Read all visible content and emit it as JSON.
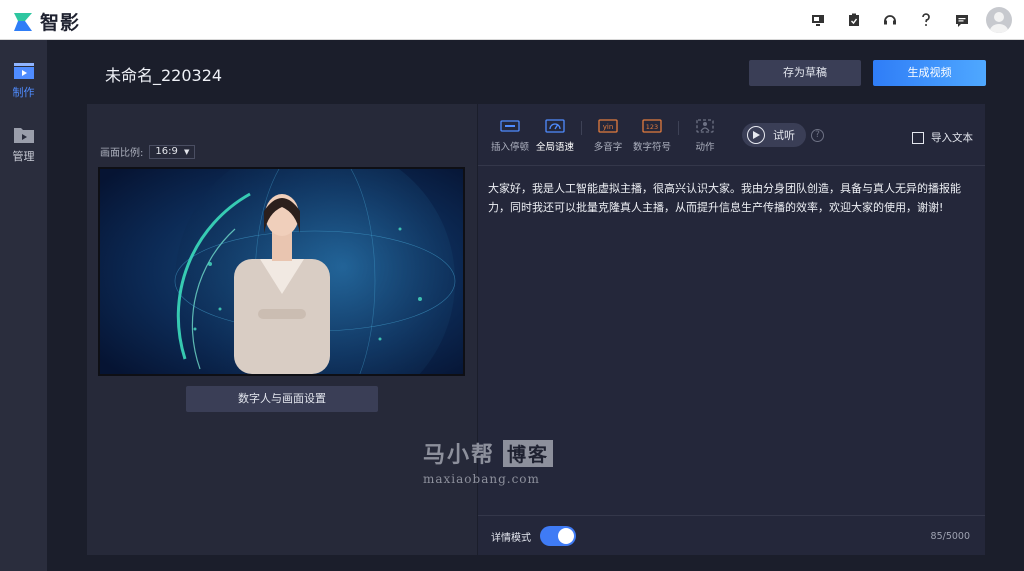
{
  "app": {
    "name": "智影"
  },
  "top_icons": [
    "monitor-icon",
    "clipboard-icon",
    "headset-icon",
    "help-icon",
    "message-icon",
    "avatar"
  ],
  "nav": {
    "items": [
      {
        "label": "制作",
        "icon": "clapperboard-icon",
        "active": true
      },
      {
        "label": "管理",
        "icon": "folder-icon",
        "active": false
      }
    ]
  },
  "header": {
    "project_title": "未命名_220324",
    "save_draft_label": "存为草稿",
    "generate_label": "生成视频"
  },
  "canvas": {
    "ratio_label": "画面比例:",
    "ratio_value": "16:9",
    "settings_label": "数字人与画面设置"
  },
  "toolbar": {
    "tools": [
      {
        "label": "插入停顿",
        "icon": "pause-insert-icon"
      },
      {
        "label": "全局语速",
        "icon": "speed-gauge-icon",
        "active": true
      },
      {
        "label": "多音字",
        "icon": "pinyin-icon"
      },
      {
        "label": "数字符号",
        "icon": "number-symbol-icon"
      },
      {
        "label": "动作",
        "icon": "gesture-icon"
      }
    ],
    "pinyin_glyph": "yin",
    "number_glyph": "123",
    "listen_label": "试听",
    "help_glyph": "?",
    "import_label": "导入文本"
  },
  "script": {
    "text": "大家好，我是人工智能虚拟主播，很高兴认识大家。我由分身团队创造，具备与真人无异的播报能力，同时我还可以批量克隆真人主播，从而提升信息生产传播的效率，欢迎大家的使用，谢谢!"
  },
  "footer": {
    "detail_mode_label": "详情模式",
    "detail_mode_on": true,
    "char_count": "85/5000"
  },
  "watermark": {
    "cn_text": "马小帮",
    "cn_box": "博客",
    "en_text": "maxiaobang.com"
  },
  "colors": {
    "accent": "#3f7bf5",
    "background": "#1b1e2b",
    "panel": "#262939"
  }
}
